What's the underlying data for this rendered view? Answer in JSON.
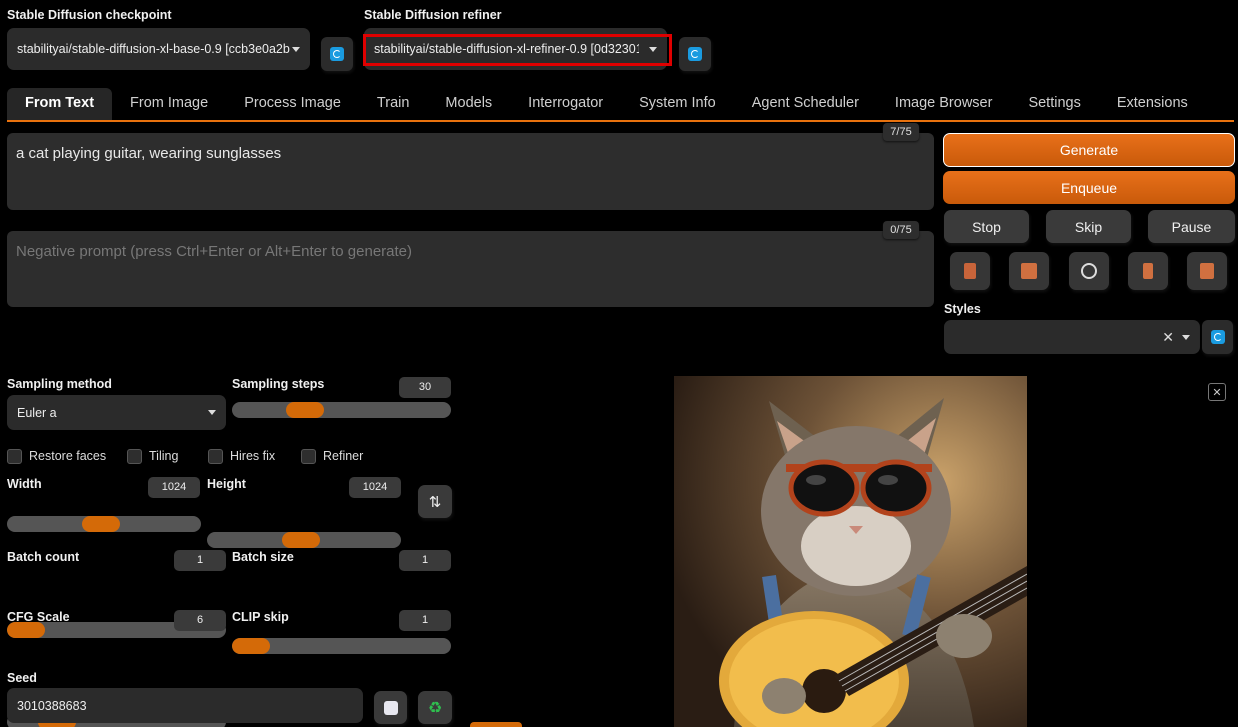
{
  "checkpoint": {
    "label": "Stable Diffusion checkpoint",
    "value": "stabilityai/stable-diffusion-xl-base-0.9 [ccb3e0a2b"
  },
  "refiner": {
    "label": "Stable Diffusion refiner",
    "value": "stabilityai/stable-diffusion-xl-refiner-0.9 [0d32301"
  },
  "tabs": [
    "From Text",
    "From Image",
    "Process Image",
    "Train",
    "Models",
    "Interrogator",
    "System Info",
    "Agent Scheduler",
    "Image Browser",
    "Settings",
    "Extensions"
  ],
  "prompt": {
    "value": "a cat playing guitar, wearing sunglasses",
    "counter": "7/75"
  },
  "negative_prompt": {
    "placeholder": "Negative prompt (press Ctrl+Enter or Alt+Enter to generate)",
    "counter": "0/75"
  },
  "actions": {
    "generate": "Generate",
    "enqueue": "Enqueue",
    "stop": "Stop",
    "skip": "Skip",
    "pause": "Pause"
  },
  "styles": {
    "label": "Styles",
    "value": ""
  },
  "sampling": {
    "method_label": "Sampling method",
    "method_value": "Euler a",
    "steps_label": "Sampling steps",
    "steps_value": "30"
  },
  "checkboxes": {
    "restore_faces": "Restore faces",
    "tiling": "Tiling",
    "hires_fix": "Hires fix",
    "refiner": "Refiner"
  },
  "width": {
    "label": "Width",
    "value": "1024"
  },
  "height": {
    "label": "Height",
    "value": "1024"
  },
  "batch_count": {
    "label": "Batch count",
    "value": "1"
  },
  "batch_size": {
    "label": "Batch size",
    "value": "1"
  },
  "cfg_scale": {
    "label": "CFG Scale",
    "value": "6"
  },
  "clip_skip": {
    "label": "CLIP skip",
    "value": "1"
  },
  "seed": {
    "label": "Seed",
    "value": "3010388683"
  },
  "colors": {
    "accent": "#e8720e",
    "highlight": "#e00000",
    "refresh": "#1a9be0"
  }
}
